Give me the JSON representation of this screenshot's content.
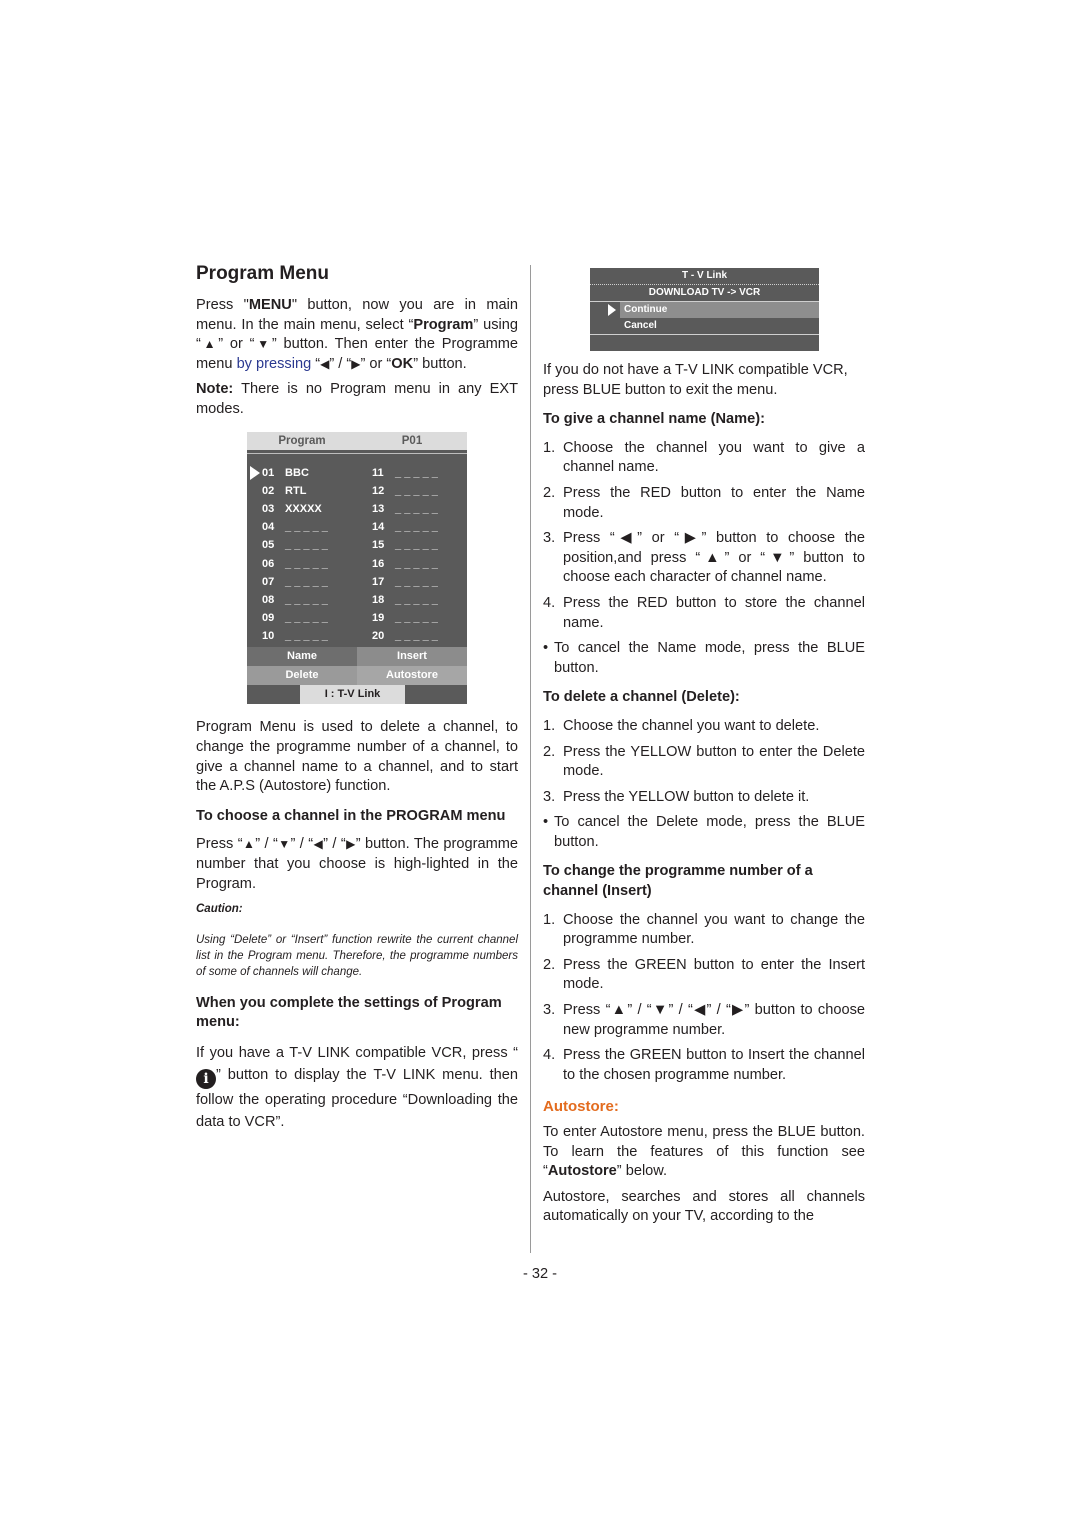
{
  "left": {
    "title": "Program Menu",
    "intro": {
      "p1_a": "Press \"",
      "p1_menu": "MENU",
      "p1_b": "\" button, now you are in main menu. In the main menu, select “",
      "p1_program": "Program",
      "p1_c": "” using “",
      "up": "▲",
      "p1_d": "” or “",
      "down": "▼",
      "p1_e": "” button. Then enter the Programme menu ",
      "p1_blue": "by pressing",
      "p1_f": " “",
      "left": "◀",
      "p1_g": "” / “",
      "right": "▶",
      "p1_h": "” or “",
      "p1_ok": "OK",
      "p1_i": "” button."
    },
    "note_label": "Note:",
    "note_text": " There is no Program menu in any EXT modes.",
    "osd": {
      "header_left": "Program",
      "header_right": "P01",
      "channels_left": [
        {
          "num": "01",
          "name": "BBC"
        },
        {
          "num": "02",
          "name": "RTL"
        },
        {
          "num": "03",
          "name": "XXXXX"
        },
        {
          "num": "04",
          "name": "_ _ _ _ _"
        },
        {
          "num": "05",
          "name": "_ _ _ _ _"
        },
        {
          "num": "06",
          "name": "_ _ _ _ _"
        },
        {
          "num": "07",
          "name": "_ _ _ _ _"
        },
        {
          "num": "08",
          "name": "_ _ _ _ _"
        },
        {
          "num": "09",
          "name": "_ _ _ _ _"
        },
        {
          "num": "10",
          "name": "_ _ _ _ _"
        }
      ],
      "channels_right": [
        {
          "num": "11",
          "name": "_ _ _ _ _"
        },
        {
          "num": "12",
          "name": "_ _ _ _ _"
        },
        {
          "num": "13",
          "name": "_ _ _ _ _"
        },
        {
          "num": "14",
          "name": "_ _ _ _ _"
        },
        {
          "num": "15",
          "name": "_ _ _ _ _"
        },
        {
          "num": "16",
          "name": "_ _ _ _ _"
        },
        {
          "num": "17",
          "name": "_ _ _ _ _"
        },
        {
          "num": "18",
          "name": "_ _ _ _ _"
        },
        {
          "num": "19",
          "name": "_ _ _ _ _"
        },
        {
          "num": "20",
          "name": "_ _ _ _ _"
        }
      ],
      "buttons": [
        "Name",
        "Insert",
        "Delete",
        "Autostore"
      ],
      "footer": "I :  T-V  Link"
    },
    "description": "Program Menu is used to delete a channel, to change the programme number of a channel, to give a channel name to a channel, and to start the A.P.S (Autostore) function.",
    "choose_heading": "To choose a channel in the PROGRAM menu",
    "choose_a": " Press “",
    "choose_b": "” /  “",
    "choose_c": "” / “",
    "choose_d": "” / “",
    "choose_e": "” button. The programme number that you choose is high-lighted in the Program.",
    "caution_title": "Caution:",
    "caution_text": "Using “Delete” or “Insert” function rewrite the current channel list in the Program menu. Therefore, the programme numbers of some of channels will change.",
    "complete_heading": "When you complete the settings of Program menu:",
    "complete_a": "If you have a T-V LINK compatible VCR, press  “",
    "info_glyph": "i",
    "complete_b": "” button to display the T-V LINK menu. then follow the operating procedure “Downloading the data to VCR”."
  },
  "right": {
    "tvlink": {
      "title": "T - V Link",
      "subtitle": "DOWNLOAD TV -> VCR",
      "options": [
        "Continue",
        "Cancel"
      ],
      "selected": "Continue"
    },
    "no_tvlink": "If you do not have a T-V LINK compatible VCR, press BLUE button to exit the menu.",
    "name_heading": "To give a channel name (Name):",
    "name_steps": [
      "Choose the channel you want to give a channel name.",
      "Press the RED button to enter the Name mode.",
      "Press “◀” or “▶” button to choose the position,and press “▲” or “▼” button to choose each character of channel name.",
      "Press the RED button to store the channel name."
    ],
    "name_note": "To cancel the Name mode, press the BLUE button.",
    "delete_heading": "To delete a channel (Delete):",
    "delete_steps": [
      "Choose the channel you want to delete.",
      "Press the YELLOW button to enter the Delete mode.",
      "Press the YELLOW button to delete it."
    ],
    "delete_note": "To cancel the Delete mode, press the BLUE button.",
    "insert_heading": "To change the programme number of a channel (Insert)",
    "insert_steps": [
      "Choose the channel you want to change the programme number.",
      "Press the GREEN button to enter the Insert mode.",
      " Press “▲” / “▼” / “◀” / “▶” button to choose new programme number.",
      "Press the GREEN button to Insert the channel to the chosen programme number."
    ],
    "autostore_heading": "Autostore:",
    "autostore_a": "To enter Autostore menu, press the BLUE button. To learn the features of this function see “",
    "autostore_bold": "Autostore",
    "autostore_b": "” below.",
    "autostore_p2": "Autostore, searches and stores all channels automatically on your TV, according to the"
  },
  "page_number": "- 32 -",
  "colors": {
    "accent_orange": "#e36c1f",
    "link_blue": "#2b3990",
    "osd_gray": "#5a5a5a"
  }
}
